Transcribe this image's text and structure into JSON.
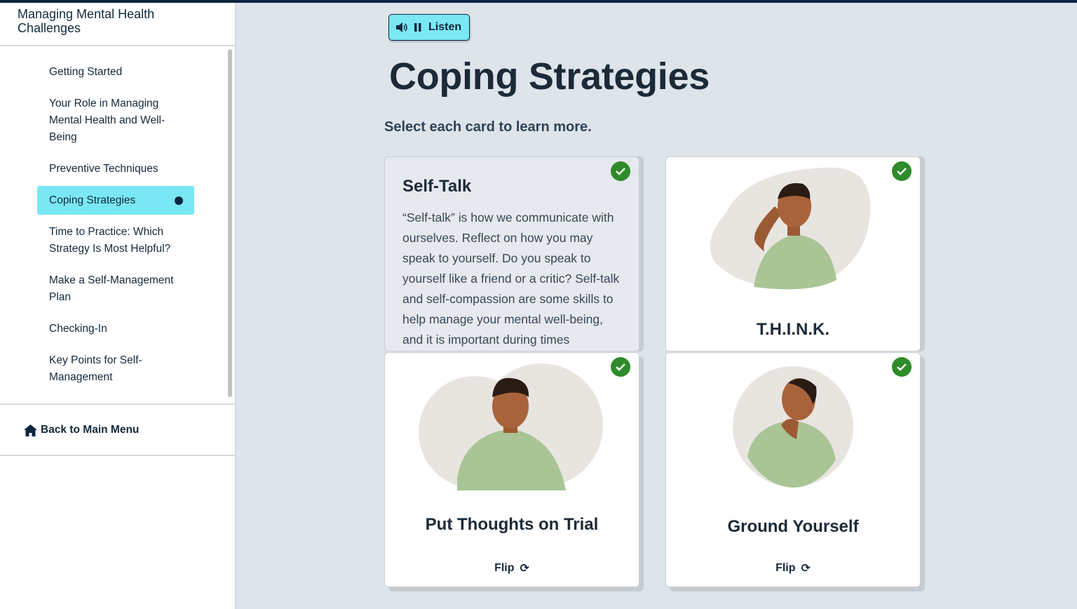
{
  "sidebar": {
    "course_title_line1": "Managing Mental Health",
    "course_title_line2": "Challenges",
    "items": [
      {
        "label": "Getting Started"
      },
      {
        "label": "Your Role in Managing Mental Health and Well-Being"
      },
      {
        "label": "Preventive Techniques"
      },
      {
        "label": "Coping Strategies",
        "active": true
      },
      {
        "label": "Time to Practice: Which Strategy Is Most Helpful?"
      },
      {
        "label": "Make a Self-Management Plan"
      },
      {
        "label": "Checking-In"
      },
      {
        "label": "Key Points for Self-Management"
      }
    ],
    "back_label": "Back to Main Menu"
  },
  "toolbar": {
    "listen_label": "Listen"
  },
  "main": {
    "title": "Coping Strategies",
    "subtitle": "Select each card to learn more.",
    "cards": [
      {
        "title": "Self-Talk",
        "body": "“Self-talk” is how we communicate with ourselves. Reflect on how you may speak to yourself. Do you speak to yourself like a friend or a critic? Self-talk and self-compassion are some skills to help manage your mental well-being, and it is important during times",
        "completed": true
      },
      {
        "title": "T.H.I.N.K.",
        "completed": true
      },
      {
        "title": "Put Thoughts on Trial",
        "flip_label": "Flip",
        "completed": true
      },
      {
        "title": "Ground Yourself",
        "flip_label": "Flip",
        "completed": true
      }
    ]
  },
  "colors": {
    "accent": "#7ae8f4",
    "check": "#2e8b2a",
    "navy": "#0b2540"
  }
}
